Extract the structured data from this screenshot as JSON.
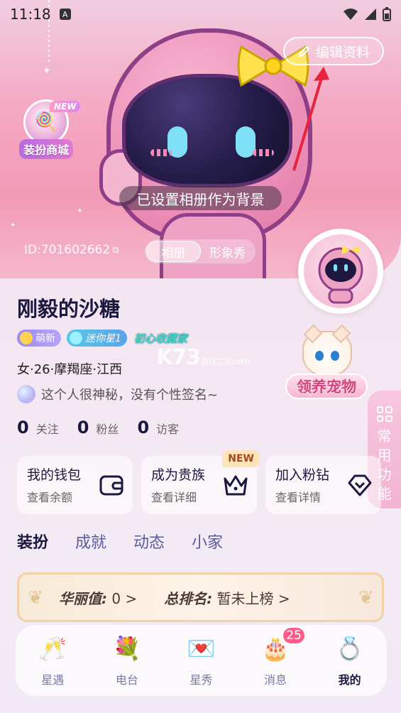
{
  "status_bar": {
    "time": "11:18",
    "notif_icon": "A"
  },
  "header": {
    "edit_label": "编辑资料",
    "shop_new": "NEW",
    "shop_label": "装扮商城",
    "toast": "已设置相册作为背景",
    "id_text": "ID:701602662",
    "segments": [
      "相册",
      "形象秀"
    ]
  },
  "profile": {
    "nickname": "刚毅的沙糖",
    "tags": [
      "萌新",
      "迷你星1",
      "初心收藏家"
    ],
    "basic": "女·26·摩羯座·江西",
    "bio": "这个人很神秘，没有个性签名~",
    "stats": [
      {
        "n": "0",
        "label": "关注"
      },
      {
        "n": "0",
        "label": "粉丝"
      },
      {
        "n": "0",
        "label": "访客"
      }
    ],
    "pet_label": "领养宠物",
    "side_tab": [
      "常",
      "用",
      "功",
      "能"
    ]
  },
  "cards": [
    {
      "title": "我的钱包",
      "sub": "查看余额",
      "icon": "wallet-icon"
    },
    {
      "title": "成为贵族",
      "sub": "查看详细",
      "icon": "crown-icon",
      "new": "NEW"
    },
    {
      "title": "加入粉钻",
      "sub": "查看详情",
      "icon": "diamond-icon"
    }
  ],
  "tabs": [
    "装扮",
    "成就",
    "动态",
    "小家"
  ],
  "rank": {
    "glam_label": "华丽值:",
    "glam_value": "0 >",
    "rank_label": "总排名:",
    "rank_value": "暂未上榜 >"
  },
  "watermark": {
    "main": "K73",
    "sub": "游戏之家",
    "domain": ".com"
  },
  "nav": [
    {
      "label": "星遇",
      "icon": "champagne-icon"
    },
    {
      "label": "电台",
      "icon": "bouquet-icon"
    },
    {
      "label": "星秀",
      "icon": "envelope-icon"
    },
    {
      "label": "消息",
      "icon": "cake-icon",
      "badge": "25"
    },
    {
      "label": "我的",
      "icon": "ring-icon"
    }
  ],
  "colors": {
    "accent": "#f39ab6",
    "text": "#1b1840",
    "badge": "#ff5c8a"
  }
}
